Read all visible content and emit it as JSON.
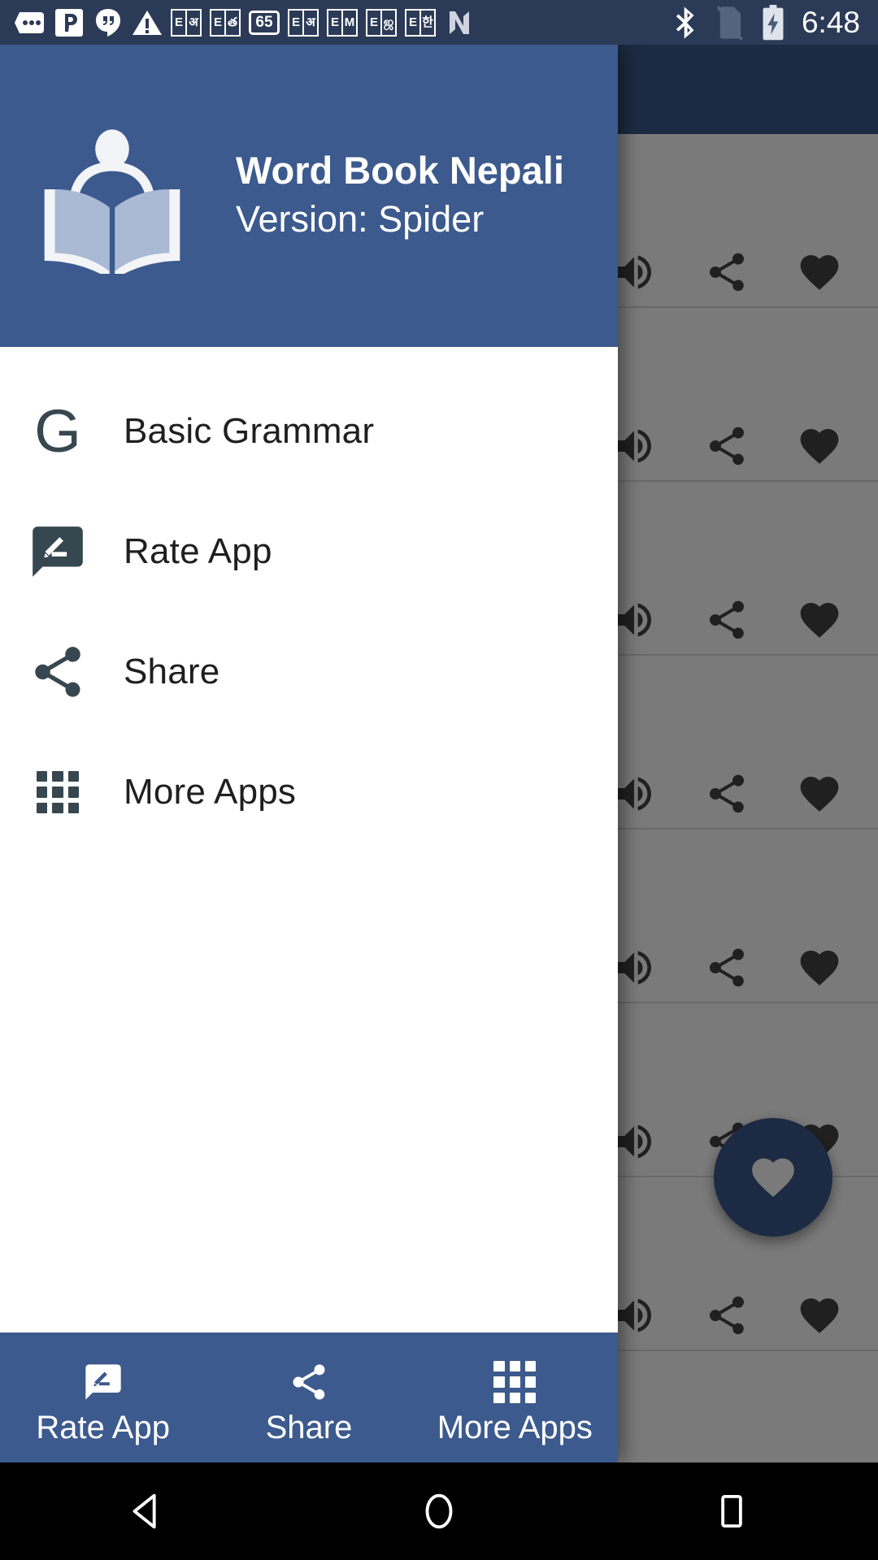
{
  "status_bar": {
    "time": "6:48",
    "left_icons": [
      {
        "name": "messages-dots-icon",
        "label": "•••"
      },
      {
        "name": "pinterest-app-icon",
        "label": "P"
      },
      {
        "name": "hangouts-quote-icon",
        "label": "”"
      },
      {
        "name": "warning-triangle-icon",
        "label": "!"
      },
      {
        "name": "dictionary-book-icon-1",
        "left": "E",
        "right": "अ"
      },
      {
        "name": "dictionary-book-icon-2",
        "left": "E",
        "right": "త"
      },
      {
        "name": "counter-badge-icon",
        "label": "65"
      },
      {
        "name": "dictionary-book-icon-3",
        "left": "E",
        "right": "अ"
      },
      {
        "name": "dictionary-book-icon-4",
        "left": "E",
        "right": "M"
      },
      {
        "name": "dictionary-book-icon-5",
        "left": "E",
        "right": "ஜ"
      },
      {
        "name": "dictionary-book-icon-6",
        "left": "E",
        "right": "한"
      },
      {
        "name": "nougat-n-icon",
        "label": "N"
      }
    ],
    "right_icons": [
      {
        "name": "bluetooth-icon"
      },
      {
        "name": "no-sim-card-icon"
      },
      {
        "name": "battery-charging-icon"
      }
    ]
  },
  "drawer": {
    "app_title": "Word Book Nepali",
    "app_version": "Version: Spider",
    "logo_icon": "person-reading-book-icon",
    "items": [
      {
        "label": "Basic Grammar",
        "icon": "grammar-g-icon",
        "name": "basic-grammar"
      },
      {
        "label": "Rate App",
        "icon": "rate-review-icon",
        "name": "rate-app"
      },
      {
        "label": "Share",
        "icon": "share-icon",
        "name": "share"
      },
      {
        "label": "More Apps",
        "icon": "apps-grid-icon",
        "name": "more-apps"
      }
    ],
    "bottom_bar": [
      {
        "label": "Rate App",
        "icon": "rate-review-icon",
        "name": "rate-app"
      },
      {
        "label": "Share",
        "icon": "share-icon",
        "name": "share"
      },
      {
        "label": "More Apps",
        "icon": "apps-grid-icon",
        "name": "more-apps"
      }
    ]
  },
  "background_app": {
    "row_icons": [
      "volume-speaker-icon",
      "share-icon",
      "heart-icon"
    ],
    "row_count": 7,
    "fab_icon": "heart-icon"
  },
  "android_nav": {
    "back": "back-triangle-icon",
    "home": "home-circle-icon",
    "recents": "recents-square-icon"
  },
  "colors": {
    "primary": "#3c5a8d",
    "status_bar": "#2b3b57",
    "toolbar_dim": "#1c2840",
    "drawer_bg": "#ffffff",
    "icon_dark": "#37474f",
    "text_dark": "#1f1f1f",
    "scrim": "rgba(0,0,0,0.52)",
    "nav_bar": "#000000"
  }
}
